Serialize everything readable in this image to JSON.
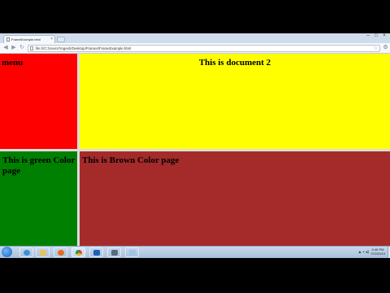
{
  "browser": {
    "tab_title": "FrameExample.html",
    "address": "file:///C:/Users/Yogesh/Desktop/Frames/FrameExample.html"
  },
  "frames": {
    "menu": {
      "text": "menu",
      "color": "#ff0000"
    },
    "document2": {
      "text": "This is document 2",
      "color": "#ffff00"
    },
    "green_page": {
      "text": "This is green Color page",
      "color": "#008000"
    },
    "brown_page": {
      "text": "This is Brown Color page",
      "color": "#a52a2a"
    }
  },
  "taskbar": {
    "time": "5:46 PM",
    "date": "7/22/2013",
    "apps": [
      "start-orb",
      "internet-explorer",
      "file-explorer",
      "firefox",
      "chrome",
      "outlook",
      "screen-recorder",
      "notepad"
    ]
  }
}
